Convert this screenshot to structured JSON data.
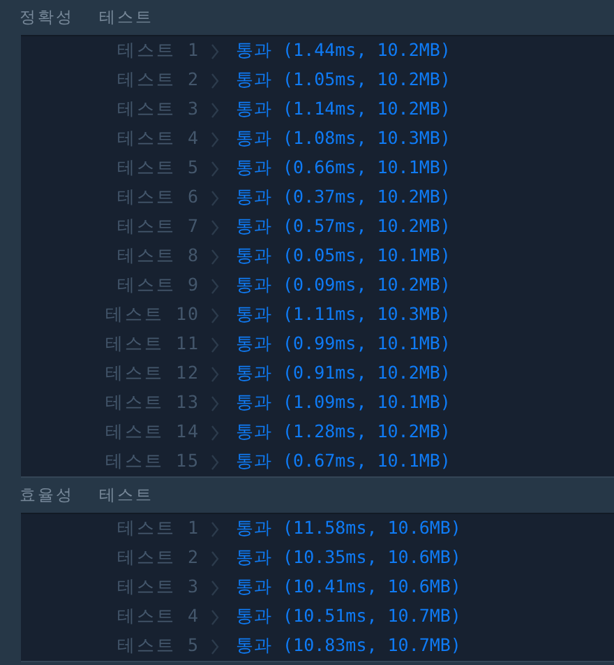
{
  "sections": [
    {
      "title": "정확성 테스트",
      "tests": [
        {
          "label": "테스트 1",
          "result": "통과 (1.44ms, 10.2MB)"
        },
        {
          "label": "테스트 2",
          "result": "통과 (1.05ms, 10.2MB)"
        },
        {
          "label": "테스트 3",
          "result": "통과 (1.14ms, 10.2MB)"
        },
        {
          "label": "테스트 4",
          "result": "통과 (1.08ms, 10.3MB)"
        },
        {
          "label": "테스트 5",
          "result": "통과 (0.66ms, 10.1MB)"
        },
        {
          "label": "테스트 6",
          "result": "통과 (0.37ms, 10.2MB)"
        },
        {
          "label": "테스트 7",
          "result": "통과 (0.57ms, 10.2MB)"
        },
        {
          "label": "테스트 8",
          "result": "통과 (0.05ms, 10.1MB)"
        },
        {
          "label": "테스트 9",
          "result": "통과 (0.09ms, 10.2MB)"
        },
        {
          "label": "테스트 10",
          "result": "통과 (1.11ms, 10.3MB)"
        },
        {
          "label": "테스트 11",
          "result": "통과 (0.99ms, 10.1MB)"
        },
        {
          "label": "테스트 12",
          "result": "통과 (0.91ms, 10.2MB)"
        },
        {
          "label": "테스트 13",
          "result": "통과 (1.09ms, 10.1MB)"
        },
        {
          "label": "테스트 14",
          "result": "통과 (1.28ms, 10.2MB)"
        },
        {
          "label": "테스트 15",
          "result": "통과 (0.67ms, 10.1MB)"
        }
      ]
    },
    {
      "title": "효율성 테스트",
      "tests": [
        {
          "label": "테스트 1",
          "result": "통과 (11.58ms, 10.6MB)"
        },
        {
          "label": "테스트 2",
          "result": "통과 (10.35ms, 10.6MB)"
        },
        {
          "label": "테스트 3",
          "result": "통과 (10.41ms, 10.6MB)"
        },
        {
          "label": "테스트 4",
          "result": "통과 (10.51ms, 10.7MB)"
        },
        {
          "label": "테스트 5",
          "result": "통과 (10.83ms, 10.7MB)"
        }
      ]
    }
  ]
}
